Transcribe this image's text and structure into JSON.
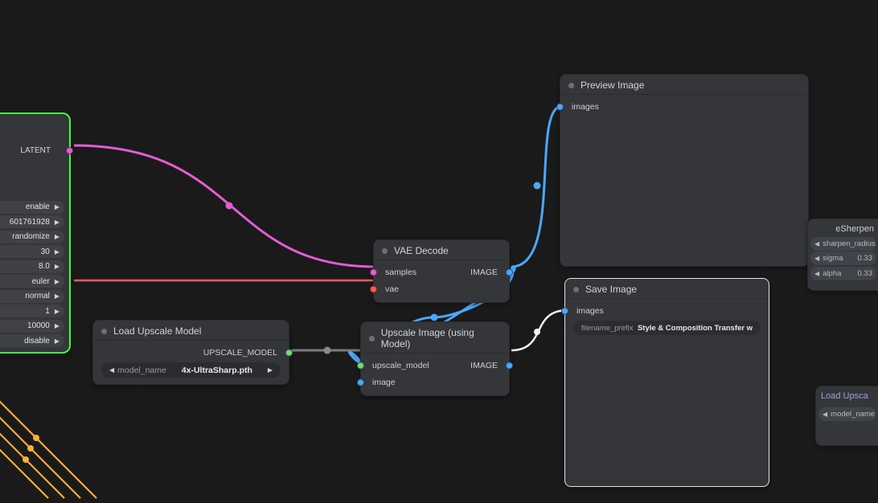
{
  "ksampler": {
    "output_label": "LATENT",
    "params": [
      "enable",
      "601761928",
      "randomize",
      "30",
      "8.0",
      "euler",
      "normal",
      "1",
      "10000",
      "disable"
    ]
  },
  "loadUpscale": {
    "title": "Load Upscale Model",
    "output": "UPSCALE_MODEL",
    "widget_label": "model_name",
    "widget_value": "4x-UltraSharp.pth"
  },
  "vaeDecode": {
    "title": "VAE Decode",
    "in1": "samples",
    "in2": "vae",
    "out": "IMAGE"
  },
  "upscaleImg": {
    "title": "Upscale Image (using Model)",
    "in1": "upscale_model",
    "in2": "image",
    "out": "IMAGE"
  },
  "preview": {
    "title": "Preview Image",
    "in": "images"
  },
  "save": {
    "title": "Save Image",
    "in": "images",
    "widget_label": "filename_prefix",
    "widget_value": "Style & Composition Transfer w"
  },
  "sherpen": {
    "title": "eSherpen",
    "rows": [
      {
        "label": "sharpen_radius",
        "value": ""
      },
      {
        "label": "sigma",
        "value": "0.33"
      },
      {
        "label": "alpha",
        "value": "0.33"
      }
    ]
  },
  "loadUps2": {
    "title": "Load Upsca",
    "widget_label": "model_name"
  },
  "colors": {
    "latent": "#e65bd4",
    "vae": "#ff5a5a",
    "model": "#7bd67b",
    "image": "#4aa8ff",
    "white": "#f2f2f2"
  }
}
